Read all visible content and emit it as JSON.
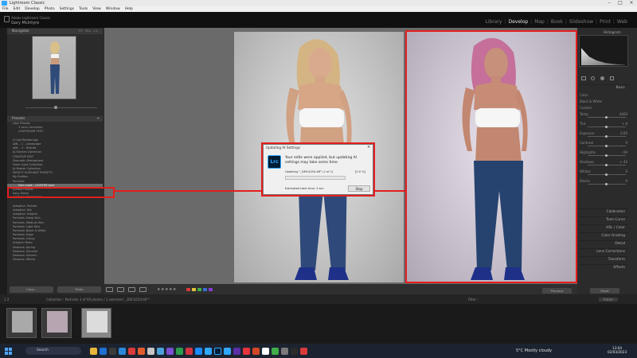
{
  "app": {
    "title": "Lightroom Classic"
  },
  "menu": [
    "File",
    "Edit",
    "Develop",
    "Photo",
    "Settings",
    "Tools",
    "View",
    "Window",
    "Help"
  ],
  "identity": {
    "line1": "Adobe Lightroom Classic",
    "line2": "Gary McIntyre"
  },
  "modules": [
    "Library",
    "Develop",
    "Map",
    "Book",
    "Slideshow",
    "Print",
    "Web"
  ],
  "active_module": "Develop",
  "navigator": {
    "title": "Navigator",
    "options": [
      "FIT",
      "FILL",
      "1:1"
    ]
  },
  "presets": {
    "title": "Presets",
    "items": [
      {
        "label": "User Presets",
        "kind": "grp"
      },
      {
        "label": "1 Lens Correction",
        "kind": "sub"
      },
      {
        "label": "LIGHTROOM TEST",
        "kind": "sub"
      },
      {
        "label": "",
        "kind": "sub"
      },
      {
        "label": "4 Cool Renderings",
        "kind": "grp"
      },
      {
        "label": "AML - 1 - Landscape",
        "kind": "grp"
      },
      {
        "label": "AML - 3 - Portrait",
        "kind": "grp"
      },
      {
        "label": "AJ Kitchen Collection",
        "kind": "grp"
      },
      {
        "label": "CREATIVE EDIT",
        "kind": "grp"
      },
      {
        "label": "Dramatic Atmosphere",
        "kind": "grp"
      },
      {
        "label": "Fresh Light Collection",
        "kind": "grp"
      },
      {
        "label": "JA Master Collection",
        "kind": "grp"
      },
      {
        "label": "MIGHTY ELEPHANT PRESETS",
        "kind": "grp"
      },
      {
        "label": "My Profiles",
        "kind": "grp"
      },
      {
        "label": "Portraits",
        "kind": "grp"
      },
      {
        "label": "Hair mask - LIGHTER tone",
        "kind": "sub",
        "highlight": true
      },
      {
        "label": "Sunset Presets",
        "kind": "grp"
      },
      {
        "label": "Sony Steep",
        "kind": "grp"
      },
      {
        "label": "WORK IN PROGRESS",
        "kind": "grp"
      },
      {
        "label": "",
        "kind": "grp"
      },
      {
        "label": "Adaptive: Portrait",
        "kind": "grp"
      },
      {
        "label": "Adaptive: Sky",
        "kind": "grp"
      },
      {
        "label": "Adaptive: Subject",
        "kind": "grp"
      },
      {
        "label": "Portraits: Deep Skin",
        "kind": "grp"
      },
      {
        "label": "Portraits: Medium Skin",
        "kind": "grp"
      },
      {
        "label": "Portraits: Light Skin",
        "kind": "grp"
      },
      {
        "label": "Portraits: Black & White",
        "kind": "grp"
      },
      {
        "label": "Portraits: Edge",
        "kind": "grp"
      },
      {
        "label": "Portraits: Group",
        "kind": "grp"
      },
      {
        "label": "Subject: Retro",
        "kind": "grp"
      },
      {
        "label": "Seasons: Spring",
        "kind": "grp"
      },
      {
        "label": "Seasons: Summer",
        "kind": "grp"
      },
      {
        "label": "Seasons: Autumn",
        "kind": "grp"
      },
      {
        "label": "Seasons: Winter",
        "kind": "grp"
      }
    ]
  },
  "left_buttons": {
    "copy": "Copy...",
    "paste": "Paste"
  },
  "histogram": {
    "title": "Histogram"
  },
  "right_panel": {
    "basic": "Basic",
    "sections": [
      "Calibration",
      "Tone Curve",
      "HSL / Color",
      "Color Grading",
      "Detail",
      "Lens Corrections",
      "Transform",
      "Effects"
    ],
    "rows": [
      "Color",
      "Black & White",
      "Custom",
      "Temp",
      "Tint",
      "Exposure",
      "Contrast",
      "Highlights",
      "Shadows",
      "Whites",
      "Blacks"
    ],
    "values": [
      "4400",
      "+ 8",
      "0.00",
      "0",
      "- 69",
      "+ 42",
      "0",
      "0"
    ],
    "previous": "Previous",
    "reset": "Reset"
  },
  "toolbar": {
    "stars": "★★★★★",
    "swatches": [
      "#d43a3a",
      "#e0c23a",
      "#3fae4a",
      "#3a6fd4",
      "#8a3ad4"
    ]
  },
  "filmstrip": {
    "page": "1  2",
    "path": "Collection : Portraits",
    "count": "3 of 60 photos / 1 selected / _DSC4254.tiff *",
    "filter_label": "Filter:",
    "filter_value": "Rated",
    "thumbs": 3
  },
  "dialog": {
    "title": "Updating AI Settings",
    "logo": "Lrc",
    "message": "Your edits were applied, but updating AI settings may take some time.",
    "status": "Updating \"_DMC4254.tiff\" (1 of 1)",
    "percent": "[0.0 %]",
    "progress": 0.0,
    "estimate": "Estimated total time: 3 sec",
    "stop": "Stop"
  },
  "taskbar": {
    "search": "Search",
    "weather": "5°C  Mostly cloudy",
    "time": "13:04",
    "date": "02/03/2023"
  }
}
